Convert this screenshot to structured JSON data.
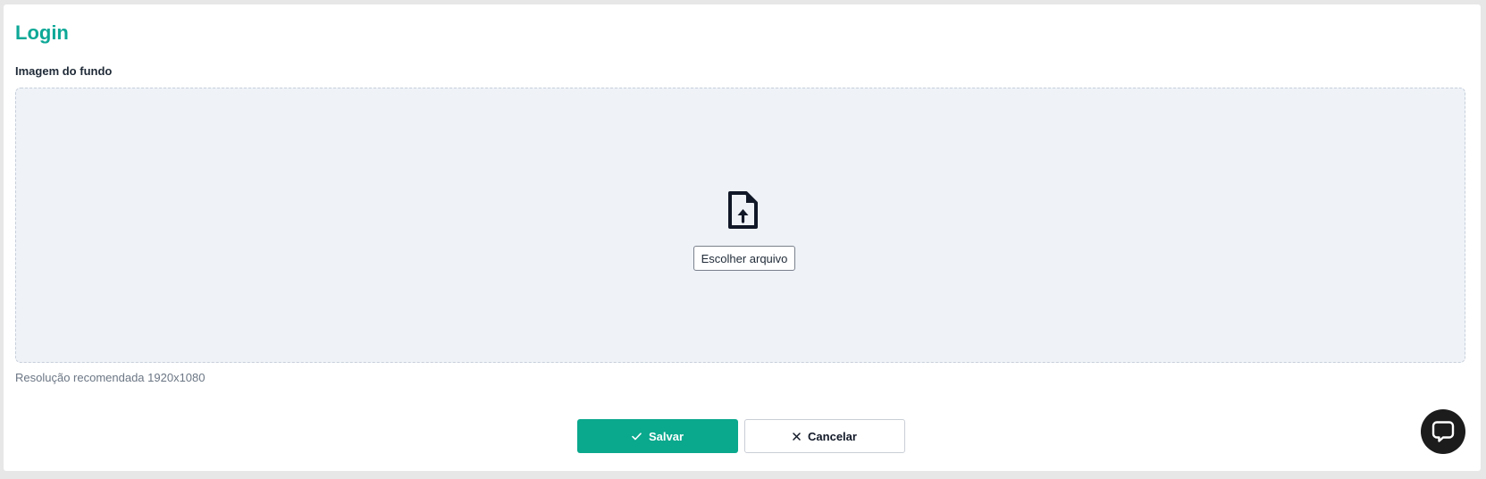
{
  "page": {
    "title": "Login"
  },
  "background_image_field": {
    "label": "Imagem do fundo",
    "choose_file_label": "Escolher arquivo",
    "upload_icon": "file-upload-icon",
    "hint": "Resolução recomendada 1920x1080"
  },
  "actions": {
    "save_label": "Salvar",
    "save_icon": "check-icon",
    "cancel_label": "Cancelar",
    "cancel_icon": "close-icon"
  },
  "chat": {
    "icon": "chat-bubble-icon"
  },
  "colors": {
    "accent": "#0ea897",
    "save_button": "#0aa88d",
    "dropzone_bg": "#eff3f8",
    "chat_bg": "#1c1c1c"
  }
}
